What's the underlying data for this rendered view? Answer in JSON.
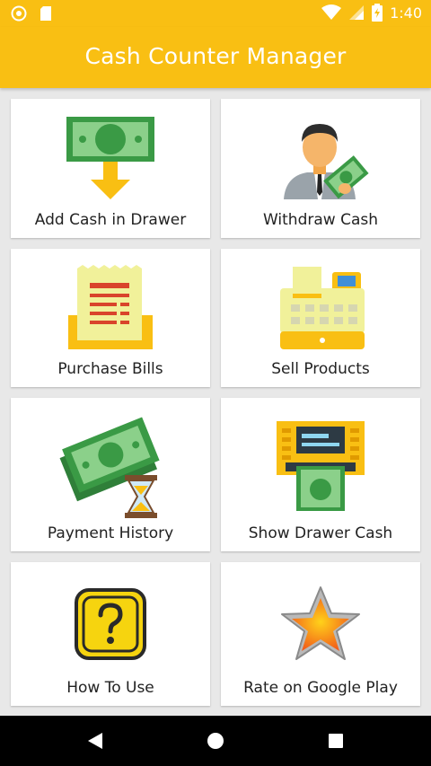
{
  "status_bar": {
    "time": "1:40",
    "icons": [
      "settings-notification-icon",
      "sd-card-icon",
      "wifi-icon",
      "signal-icon",
      "battery-icon"
    ]
  },
  "app_bar": {
    "title": "Cash Counter Manager"
  },
  "menu": [
    {
      "label": "Add Cash in Drawer",
      "icon": "cash-in-drawer-icon"
    },
    {
      "label": "Withdraw Cash",
      "icon": "withdraw-cash-icon"
    },
    {
      "label": "Purchase Bills",
      "icon": "purchase-bills-icon"
    },
    {
      "label": "Sell Products",
      "icon": "cash-register-icon"
    },
    {
      "label": "Payment History",
      "icon": "payment-history-icon"
    },
    {
      "label": "Show Drawer Cash",
      "icon": "atm-cash-icon"
    },
    {
      "label": "How To Use",
      "icon": "help-icon"
    },
    {
      "label": "Rate on Google Play",
      "icon": "star-icon"
    }
  ],
  "nav_bar": {
    "icons": [
      "back-icon",
      "home-icon",
      "recents-icon"
    ]
  },
  "colors": {
    "accent": "#f9bf13",
    "background": "#e8e8e8",
    "card": "#ffffff"
  }
}
